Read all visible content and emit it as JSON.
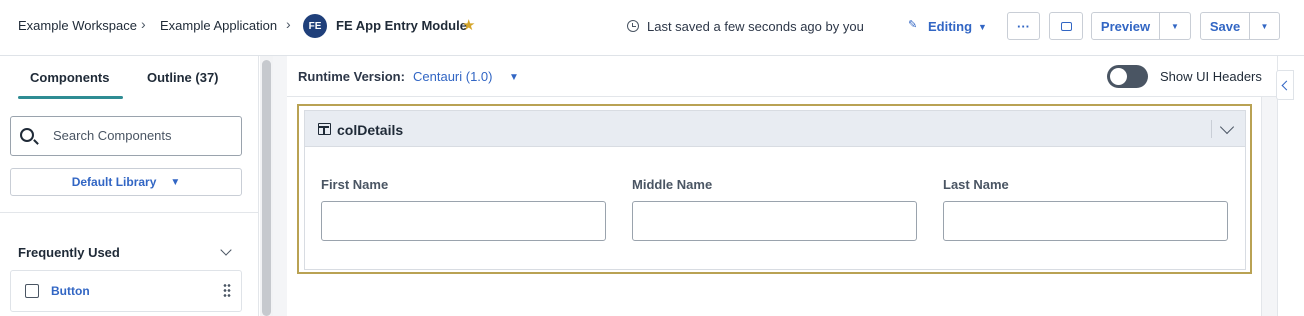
{
  "breadcrumb": {
    "workspace": "Example Workspace",
    "application": "Example Application",
    "module_initials": "FE",
    "module_name": "FE App Entry Module"
  },
  "status": {
    "saved_text": "Last saved a few seconds ago by you",
    "mode_label": "Editing"
  },
  "toolbar": {
    "more_label": "···",
    "preview_label": "Preview",
    "save_label": "Save"
  },
  "sidebar": {
    "tabs": [
      {
        "label": "Components",
        "active": true
      },
      {
        "label": "Outline (37)",
        "active": false
      }
    ],
    "search_placeholder": "Search Components",
    "library": "Default Library",
    "section_title": "Frequently Used",
    "items": [
      {
        "label": "Button",
        "icon": "square-icon"
      }
    ]
  },
  "canvas": {
    "runtime_label": "Runtime Version:",
    "runtime_value": "Centauri (1.0)",
    "show_headers_label": "Show UI Headers",
    "show_headers_on": false
  },
  "container": {
    "title": "colDetails",
    "fields": [
      {
        "label": "First Name",
        "value": ""
      },
      {
        "label": "Middle Name",
        "value": ""
      },
      {
        "label": "Last Name",
        "value": ""
      }
    ]
  },
  "colors": {
    "accent": "#3266c4",
    "selection": "#b9a253",
    "tab_indicator": "#2f8c93",
    "star": "#d4a52a"
  }
}
